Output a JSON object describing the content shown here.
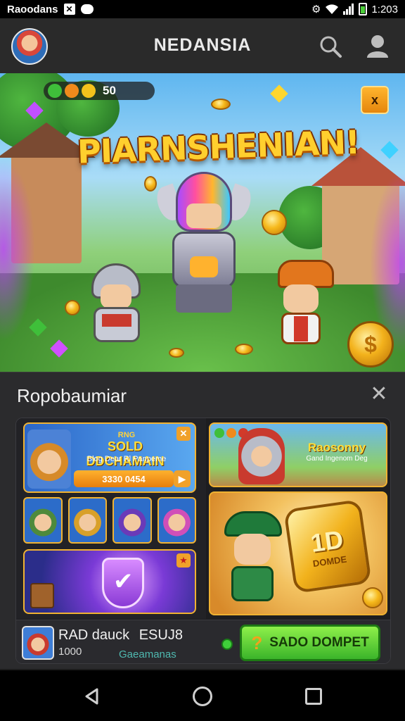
{
  "status_bar": {
    "left_text": "Raoodans",
    "time": "1:203"
  },
  "app_bar": {
    "title": "NEDANSIA"
  },
  "hero": {
    "coins_text": "50",
    "badge_text": "x",
    "title": "PIARNSHENIAN!",
    "big_coin_symbol": "$"
  },
  "sheet": {
    "title": "Ropobaumiar",
    "close_symbol": "✕",
    "card_top": {
      "small_label": "RNG",
      "title": "SOLD DDCHAMAIN",
      "subtitle": "Blog Dear Rl Panpeme",
      "bar_text": "3330 0454",
      "close_symbol": "✕",
      "play_symbol": "▶"
    },
    "card_right_top": {
      "title": "Raosonny",
      "subtitle": "Gand Ingenom Deg"
    },
    "card_right_big": {
      "big_text": "1D",
      "small_text": "DOMDE"
    },
    "card_shield": {
      "check_symbol": "✔",
      "star_symbol": "★"
    },
    "footer": {
      "name": "RAD dauck",
      "extra": "ESUJ8",
      "count": "1000",
      "sub": "Gaeamanas",
      "cta_label": "SADO DOMPET",
      "cta_icon": "?"
    }
  },
  "colors": {
    "accent_green": "#3bb42a",
    "accent_gold": "#f0b232",
    "sheet_bg": "#2b2b2d"
  }
}
